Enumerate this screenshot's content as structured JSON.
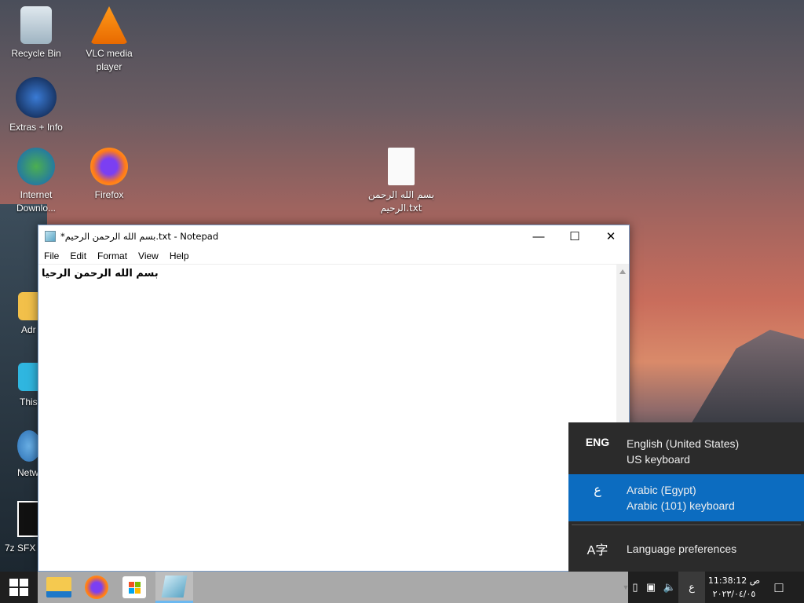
{
  "desktop": {
    "icons": [
      {
        "label": "Recycle Bin"
      },
      {
        "label": "VLC media player"
      },
      {
        "label": "Extras + Info"
      },
      {
        "label": "Internet Downlo..."
      },
      {
        "label": "Firefox"
      },
      {
        "label": "بسم الله الرحمن الرحيم.txt"
      },
      {
        "label": "Adr"
      },
      {
        "label": "This"
      },
      {
        "label": "Netw"
      },
      {
        "label": "7z SFX"
      }
    ]
  },
  "notepad": {
    "title": "*بسم الله الرحمن الرحيم.txt - Notepad",
    "menu": [
      "File",
      "Edit",
      "Format",
      "View",
      "Help"
    ],
    "content": "بسم الله الرحمن الرحيا"
  },
  "language_flyout": {
    "items": [
      {
        "abbr": "ENG",
        "name": "English (United States)",
        "keyboard": "US keyboard",
        "selected": false
      },
      {
        "abbr": "ع",
        "name": "Arabic (Egypt)",
        "keyboard": "Arabic (101) keyboard",
        "selected": true
      }
    ],
    "preferences": "Language preferences",
    "accent": "#0c6cc0"
  },
  "taskbar": {
    "input_indicator": "ع",
    "time": "11:38:12 ص",
    "date": "٢٠٢٣/٠٤/٠٥"
  }
}
